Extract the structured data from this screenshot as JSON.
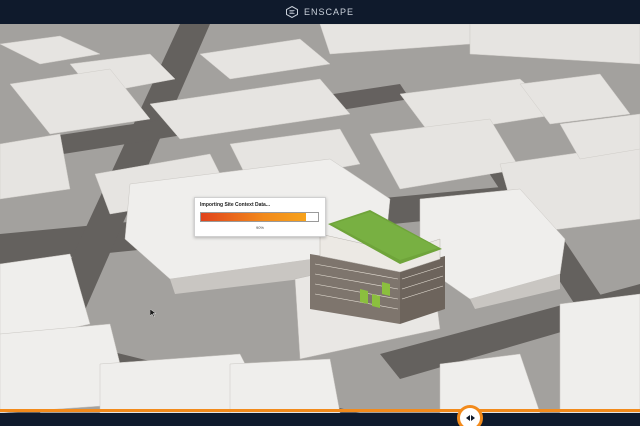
{
  "app": {
    "brand": "ENSCAPE",
    "brand_icon": "enscape-logo-icon"
  },
  "import_dialog": {
    "title": "Importing Site Context Data...",
    "progress_label": "90%",
    "progress_fraction": 0.9
  },
  "colors": {
    "accent": "#f28a1b",
    "titlebar": "#0f1a2c",
    "roof_green": "#6fa43a"
  },
  "controls": {
    "nav_icon": "left-right-arrows-icon"
  }
}
